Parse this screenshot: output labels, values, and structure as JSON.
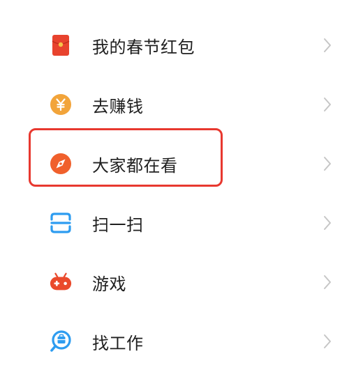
{
  "menu": {
    "items": [
      {
        "label": "我的春节红包",
        "icon": "red-envelope-icon"
      },
      {
        "label": "去赚钱",
        "icon": "yuan-coin-icon"
      },
      {
        "label": "大家都在看",
        "icon": "compass-icon"
      },
      {
        "label": "扫一扫",
        "icon": "scan-icon"
      },
      {
        "label": "游戏",
        "icon": "gamepad-icon"
      },
      {
        "label": "找工作",
        "icon": "job-search-icon"
      }
    ],
    "chevron_icon": "chevron-right-icon",
    "highlighted_item": "大家都在看"
  },
  "colors": {
    "red_envelope": "#e8432e",
    "coin": "#f2a43a",
    "compass": "#f0602c",
    "scan": "#2d9cf0",
    "gamepad": "#ea4a2c",
    "job": "#2d9cf0",
    "highlight_border": "#e8382f",
    "text": "#1f1f1f",
    "chevron": "#c6c6c6"
  }
}
